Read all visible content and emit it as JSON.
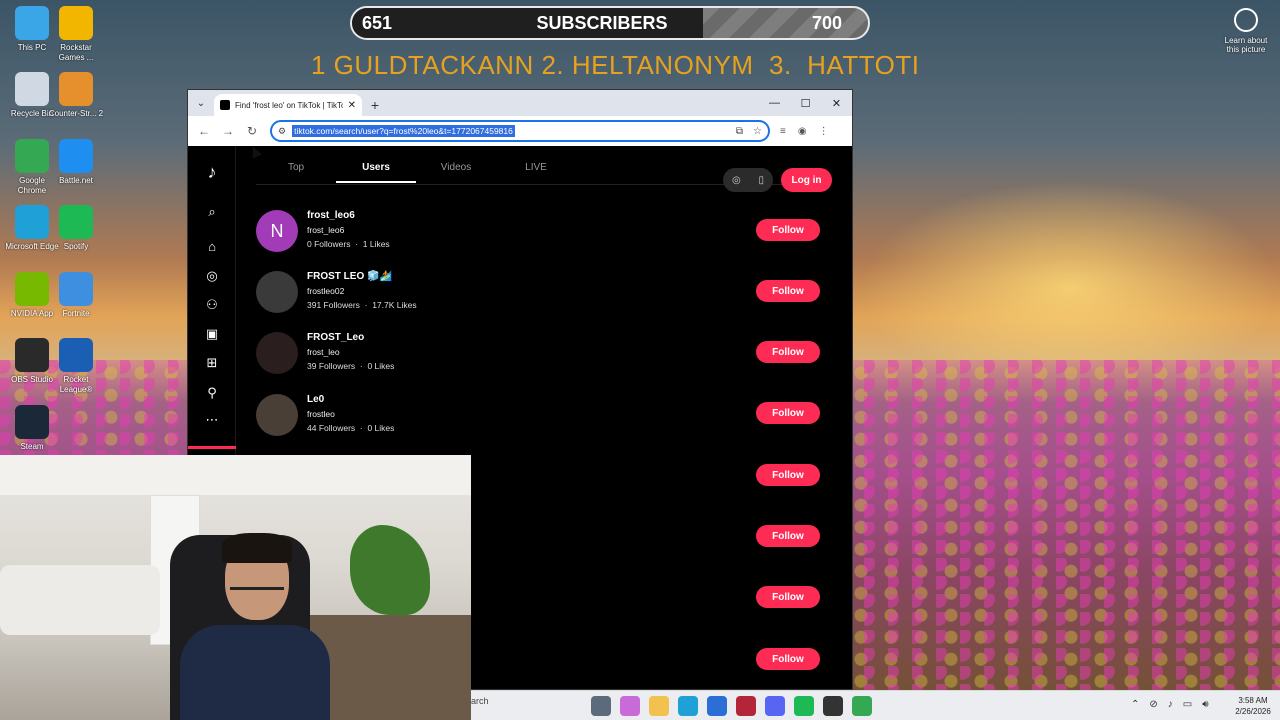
{
  "overlay": {
    "subscribers": {
      "current": "651",
      "label": "SUBSCRIBERS",
      "goal": "700",
      "progress": 0.68
    },
    "leaderboard": "1 GULDTACKANN 2. HELTANONYM  3.  HATTOTI"
  },
  "desktop": {
    "icons": [
      {
        "label": "This PC",
        "icon": "monitor-icon",
        "color": "#3aa6e8"
      },
      {
        "label": "Rockstar Games ...",
        "icon": "rockstar-icon",
        "color": "#f2b600"
      },
      {
        "label": "Recycle Bin",
        "icon": "recycle-bin-icon",
        "color": "#cfd8e3"
      },
      {
        "label": "Counter-Str... 2",
        "icon": "counter-strike-icon",
        "color": "#e6902d"
      },
      {
        "label": "Google Chrome",
        "icon": "chrome-icon",
        "color": "#34a853"
      },
      {
        "label": "Battle.net",
        "icon": "battlenet-icon",
        "color": "#1f8ef1"
      },
      {
        "label": "Microsoft Edge",
        "icon": "edge-icon",
        "color": "#1fa0d6"
      },
      {
        "label": "Spotify",
        "icon": "spotify-icon",
        "color": "#1db954"
      },
      {
        "label": "NVIDIA App",
        "icon": "nvidia-icon",
        "color": "#76b900"
      },
      {
        "label": "Fortnite",
        "icon": "fortnite-icon",
        "color": "#3f8fe0"
      },
      {
        "label": "OBS Studio",
        "icon": "obs-icon",
        "color": "#2a2a2a"
      },
      {
        "label": "Rocket League®",
        "icon": "rocket-league-icon",
        "color": "#1b5fb5"
      },
      {
        "label": "Steam",
        "icon": "steam-icon",
        "color": "#1b2838"
      }
    ],
    "learn_label": "Learn about this picture"
  },
  "browser": {
    "tab_title": "Find 'frost leo' on TikTok | TikTo",
    "url": "tiktok.com/search/user?q=frost%20leo&t=1772067459816"
  },
  "tiktok": {
    "tabs": [
      "Top",
      "Users",
      "Videos",
      "LIVE"
    ],
    "active_tab": "Users",
    "login_label": "Log in",
    "follow_label": "Follow",
    "users": [
      {
        "display": "frost_leo6",
        "handle": "frost_leo6",
        "followers": "0 Followers",
        "likes": "1 Likes",
        "initial": "N",
        "avatar_color": "#a23bb8"
      },
      {
        "display": "FROST LEO 🧊🏄",
        "handle": "frostleo02",
        "followers": "391 Followers",
        "likes": "17.7K Likes",
        "initial": "",
        "avatar_color": "#3a3a3a"
      },
      {
        "display": "FROST_Leo",
        "handle": "frost_leo",
        "followers": "39 Followers",
        "likes": "0 Likes",
        "initial": "",
        "avatar_color": "#2a1e1e"
      },
      {
        "display": "Le0",
        "handle": "frostleo",
        "followers": "44 Followers",
        "likes": "0 Likes",
        "initial": "",
        "avatar_color": "#4a3f36"
      }
    ]
  },
  "taskbar": {
    "search_text": "arch",
    "time": "3:58 AM",
    "date": "2/26/2026"
  }
}
